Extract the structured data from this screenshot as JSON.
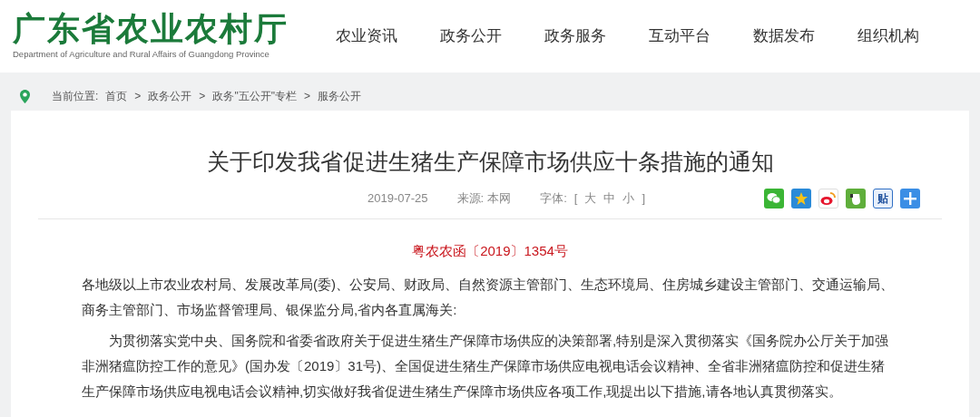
{
  "logo": {
    "title": "广东省农业农村厅",
    "subtitle": "Department of Agriculture and Rural Affairs of Guangdong Province"
  },
  "nav": [
    {
      "label": "农业资讯"
    },
    {
      "label": "政务公开"
    },
    {
      "label": "政务服务"
    },
    {
      "label": "互动平台"
    },
    {
      "label": "数据发布"
    },
    {
      "label": "组织机构"
    }
  ],
  "breadcrumb": {
    "prefix": "当前位置:",
    "items": [
      "首页",
      "政务公开",
      "政务\"五公开\"专栏",
      "服务公开"
    ],
    "separator": ">"
  },
  "article": {
    "title": "关于印发我省促进生猪生产保障市场供应十条措施的通知",
    "date": "2019-07-25",
    "source_label": "来源:",
    "source": "本网",
    "font_label": "字体:",
    "font_open": "[",
    "font_sizes": [
      "大",
      "中",
      "小"
    ],
    "font_close": "]",
    "share": [
      {
        "kind": "wechat"
      },
      {
        "kind": "qzone"
      },
      {
        "kind": "weibo"
      },
      {
        "kind": "evernote"
      },
      {
        "kind": "tieba",
        "label": "贴"
      },
      {
        "kind": "more"
      }
    ],
    "doc_number": "粤农农函〔2019〕1354号",
    "paragraphs": [
      {
        "kind": "salutation",
        "text": "各地级以上市农业农村局、发展改革局(委)、公安局、财政局、自然资源主管部门、生态环境局、住房城乡建设主管部门、交通运输局、商务主管部门、市场监督管理局、银保监分局,省内各直属海关:"
      },
      {
        "kind": "body",
        "text": "为贯彻落实党中央、国务院和省委省政府关于促进生猪生产保障市场供应的决策部署,特别是深入贯彻落实《国务院办公厅关于加强非洲猪瘟防控工作的意见》(国办发〔2019〕31号)、全国促进生猪生产保障市场供应电视电话会议精神、全省非洲猪瘟防控和促进生猪生产保障市场供应电视电话会议精神,切实做好我省促进生猪生产保障市场供应各项工作,现提出以下措施,请各地认真贯彻落实。"
      }
    ]
  }
}
